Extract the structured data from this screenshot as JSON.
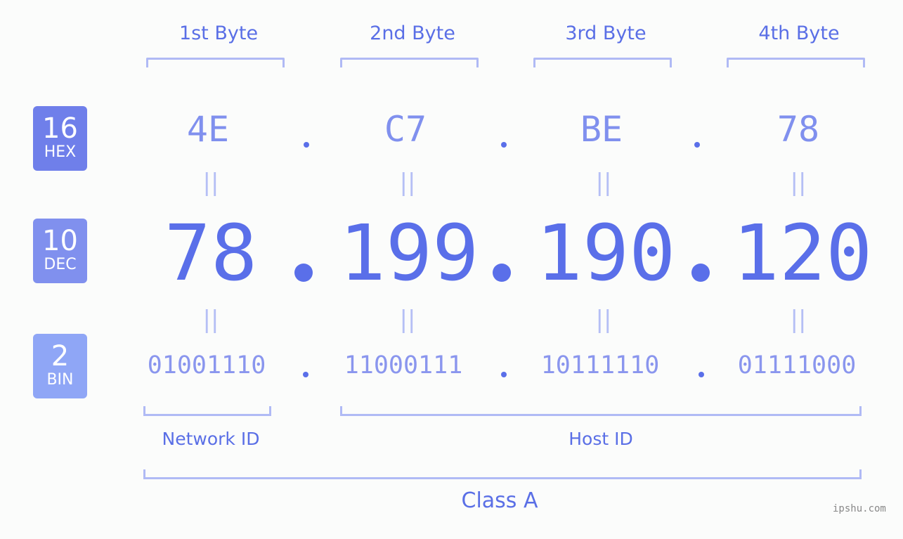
{
  "bytes": [
    {
      "label": "1st Byte",
      "hex": "4E",
      "dec": "78",
      "bin": "01001110"
    },
    {
      "label": "2nd Byte",
      "hex": "C7",
      "dec": "199",
      "bin": "11000111"
    },
    {
      "label": "3rd Byte",
      "hex": "BE",
      "dec": "190",
      "bin": "10111110"
    },
    {
      "label": "4th Byte",
      "hex": "78",
      "dec": "120",
      "bin": "01111000"
    }
  ],
  "badges": {
    "hex": {
      "num": "16",
      "label": "HEX",
      "color": "#6f7fea"
    },
    "dec": {
      "num": "10",
      "label": "DEC",
      "color": "#8090ee"
    },
    "bin": {
      "num": "2",
      "label": "BIN",
      "color": "#8fa6f6"
    }
  },
  "separator": ".",
  "equals": "||",
  "parts": {
    "network": "Network ID",
    "host": "Host ID",
    "class": "Class A"
  },
  "watermark": "ipshu.com"
}
